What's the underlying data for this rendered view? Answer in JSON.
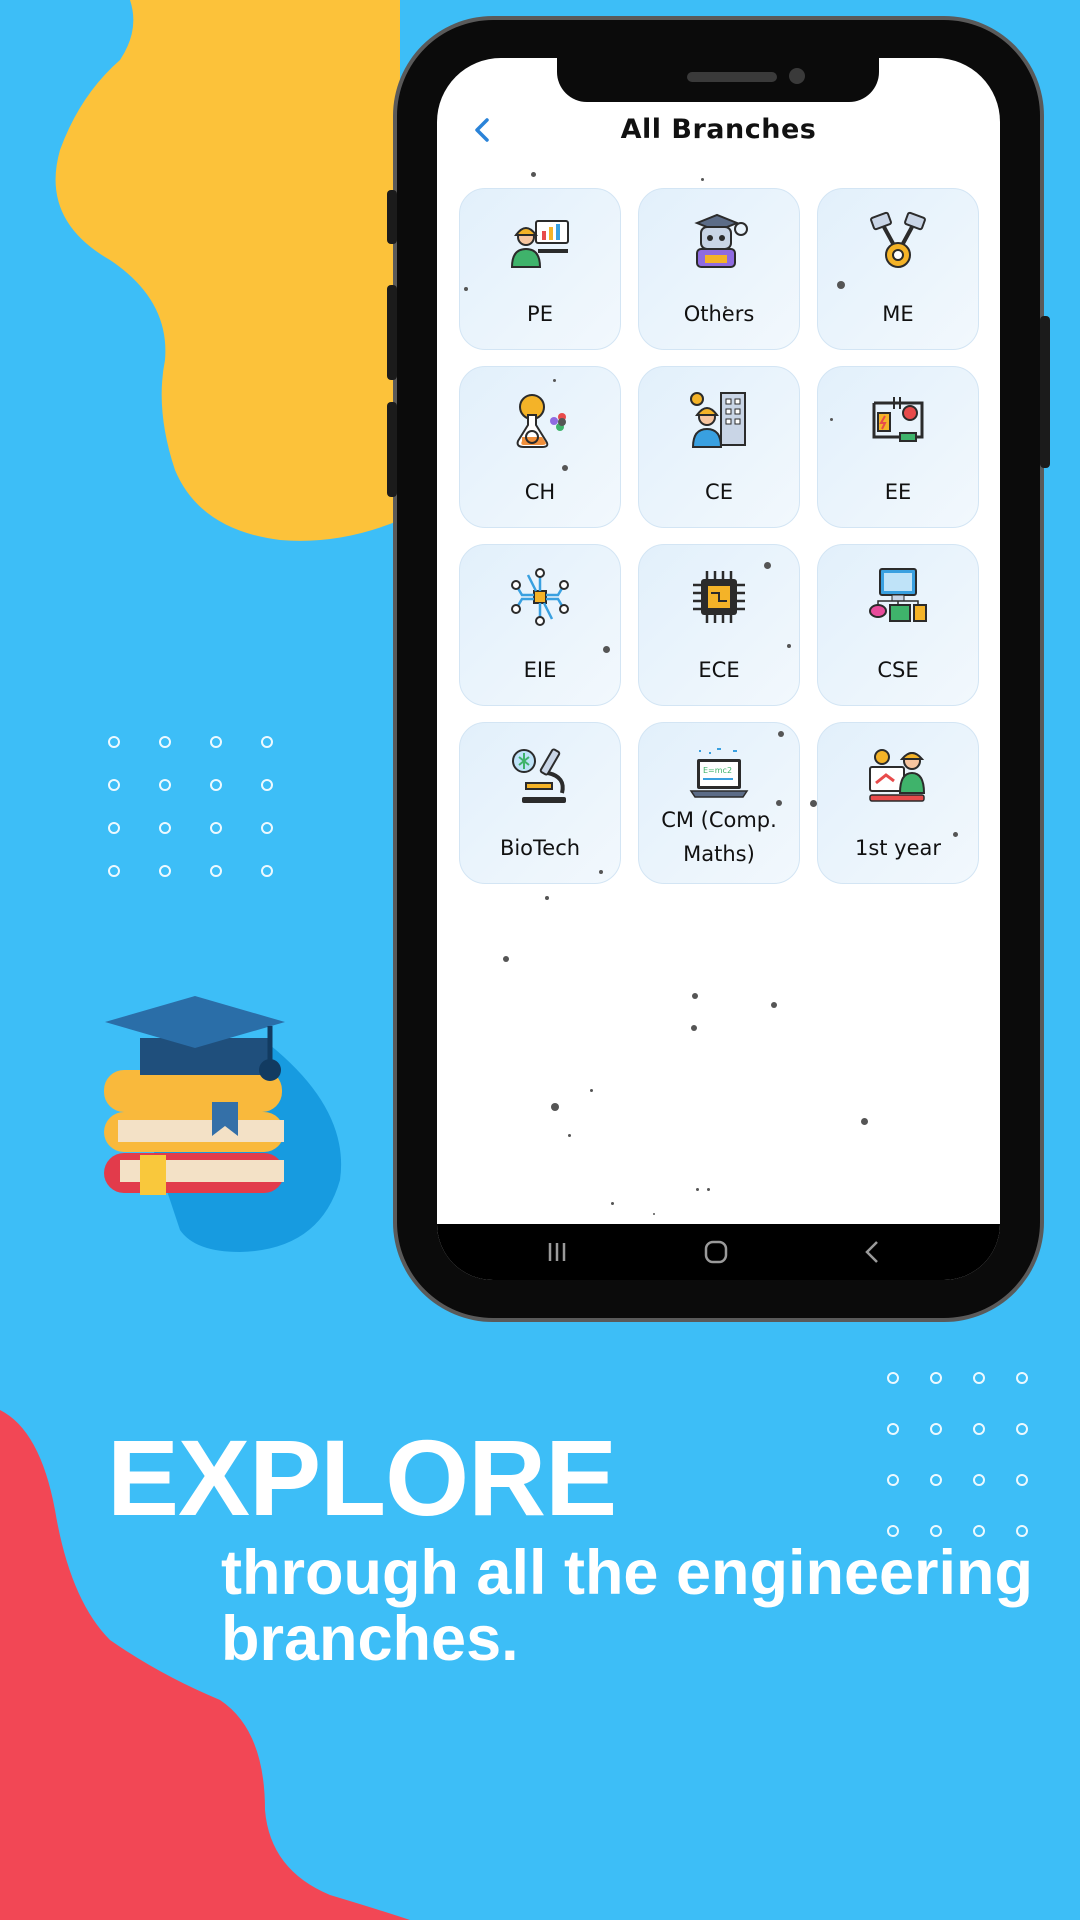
{
  "app": {
    "title": "All Branches",
    "back_icon": "back-chevron-icon"
  },
  "branches": [
    {
      "label": "PE",
      "icon": "petroleum-engineer-icon"
    },
    {
      "label": "Others",
      "icon": "robot-icon"
    },
    {
      "label": "ME",
      "icon": "pistons-gear-icon"
    },
    {
      "label": "CH",
      "icon": "chemical-flask-gear-icon"
    },
    {
      "label": "CE",
      "icon": "civil-engineer-building-icon"
    },
    {
      "label": "EE",
      "icon": "electric-circuit-icon"
    },
    {
      "label": "EIE",
      "icon": "circuit-network-icon"
    },
    {
      "label": "ECE",
      "icon": "microchip-icon"
    },
    {
      "label": "CSE",
      "icon": "computer-network-icon"
    },
    {
      "label": "BioTech",
      "icon": "microscope-icon"
    },
    {
      "label": "CM (Comp. Maths)",
      "icon": "laptop-formula-icon"
    },
    {
      "label": "1st year",
      "icon": "student-engineer-icon"
    }
  ],
  "navbar": {
    "icons": [
      "recent-apps-icon",
      "home-icon",
      "back-icon"
    ]
  },
  "promo": {
    "headline": "EXPLORE",
    "subline": "through all the engineering\nbranches."
  },
  "colors": {
    "background": "#3DBEF7",
    "blob_yellow": "#FCC23A",
    "blob_red": "#F24755",
    "accent_blue": "#2A83D8"
  }
}
